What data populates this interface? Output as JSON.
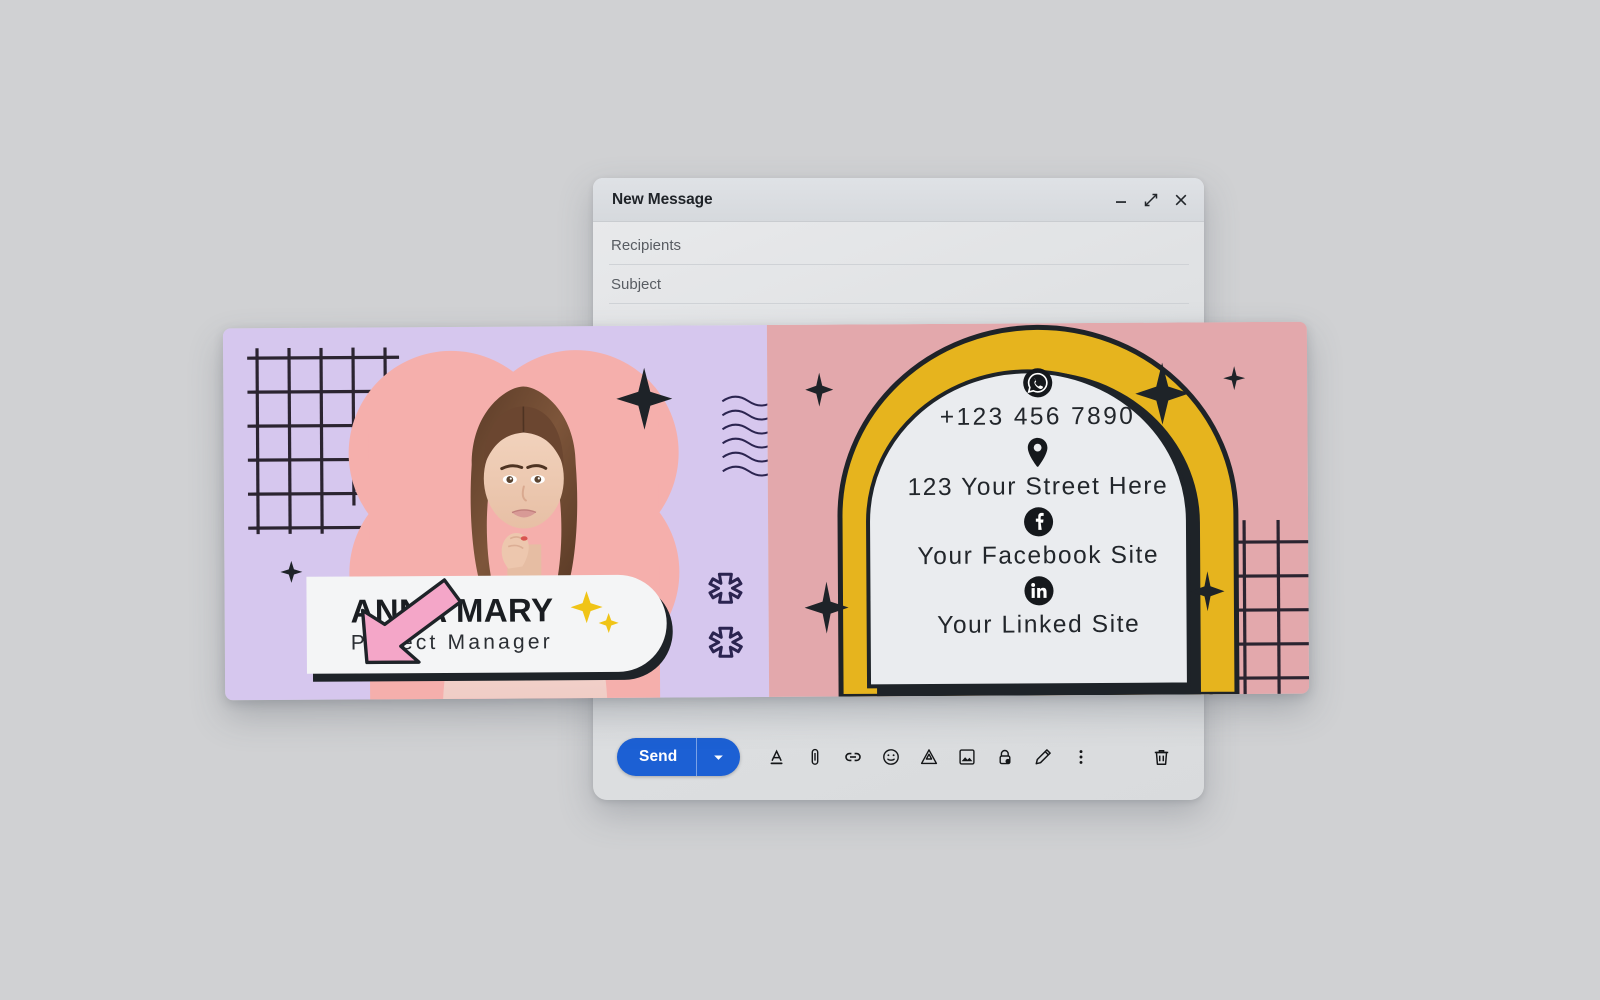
{
  "page": {
    "background_color": "#d0d1d3"
  },
  "compose_window": {
    "title": "New Message",
    "window_controls": [
      {
        "name": "minimize",
        "glyph": "minimize-icon"
      },
      {
        "name": "expand",
        "glyph": "expand-icon"
      },
      {
        "name": "close",
        "glyph": "close-icon"
      }
    ],
    "fields": [
      {
        "name": "recipients",
        "label": "Recipients",
        "value": ""
      },
      {
        "name": "subject",
        "label": "Subject",
        "value": ""
      }
    ],
    "toolbar": {
      "send_label": "Send",
      "send_color": "#1c60d4",
      "send_dropdown_icon": "chevron-down-icon",
      "icons": [
        {
          "name": "formatting-options-icon",
          "title": "Formatting options"
        },
        {
          "name": "attach-file-icon",
          "title": "Attach files"
        },
        {
          "name": "insert-link-icon",
          "title": "Insert link"
        },
        {
          "name": "insert-emoji-icon",
          "title": "Insert emoji"
        },
        {
          "name": "insert-drive-icon",
          "title": "Insert files using Drive"
        },
        {
          "name": "insert-photo-icon",
          "title": "Insert photo"
        },
        {
          "name": "confidential-mode-icon",
          "title": "Toggle confidential mode"
        },
        {
          "name": "insert-signature-icon",
          "title": "Insert signature"
        },
        {
          "name": "more-options-icon",
          "title": "More options"
        }
      ],
      "discard_icon": {
        "name": "discard-draft-icon",
        "title": "Discard draft"
      }
    }
  },
  "signature": {
    "colors": {
      "left_background": "#d6c7ee",
      "right_background": "#e3a8ac",
      "blob": "#f5afac",
      "arch_yellow": "#e6b41e",
      "arch_fill": "#eaecef",
      "outline": "#1e2328",
      "card_background": "#f4f5f6",
      "arrow_pink": "#f4a6c8",
      "sparkle_yellow": "#f0c417"
    },
    "person": {
      "name": "ANNA MARY",
      "role": "Project Manager",
      "photo_alt": "portrait-photo"
    },
    "contacts": [
      {
        "icon": "whatsapp-icon",
        "text": "+123 456 7890"
      },
      {
        "icon": "location-pin-icon",
        "text": "123 Your Street Here"
      },
      {
        "icon": "facebook-icon",
        "text": "Your Facebook Site"
      },
      {
        "icon": "linkedin-icon",
        "text": "Your Linked Site"
      }
    ],
    "decorations": [
      "grid-pattern",
      "wavy-lines",
      "asterisk-shapes",
      "four-point-stars",
      "pink-arrow",
      "sparkle-stars"
    ]
  }
}
